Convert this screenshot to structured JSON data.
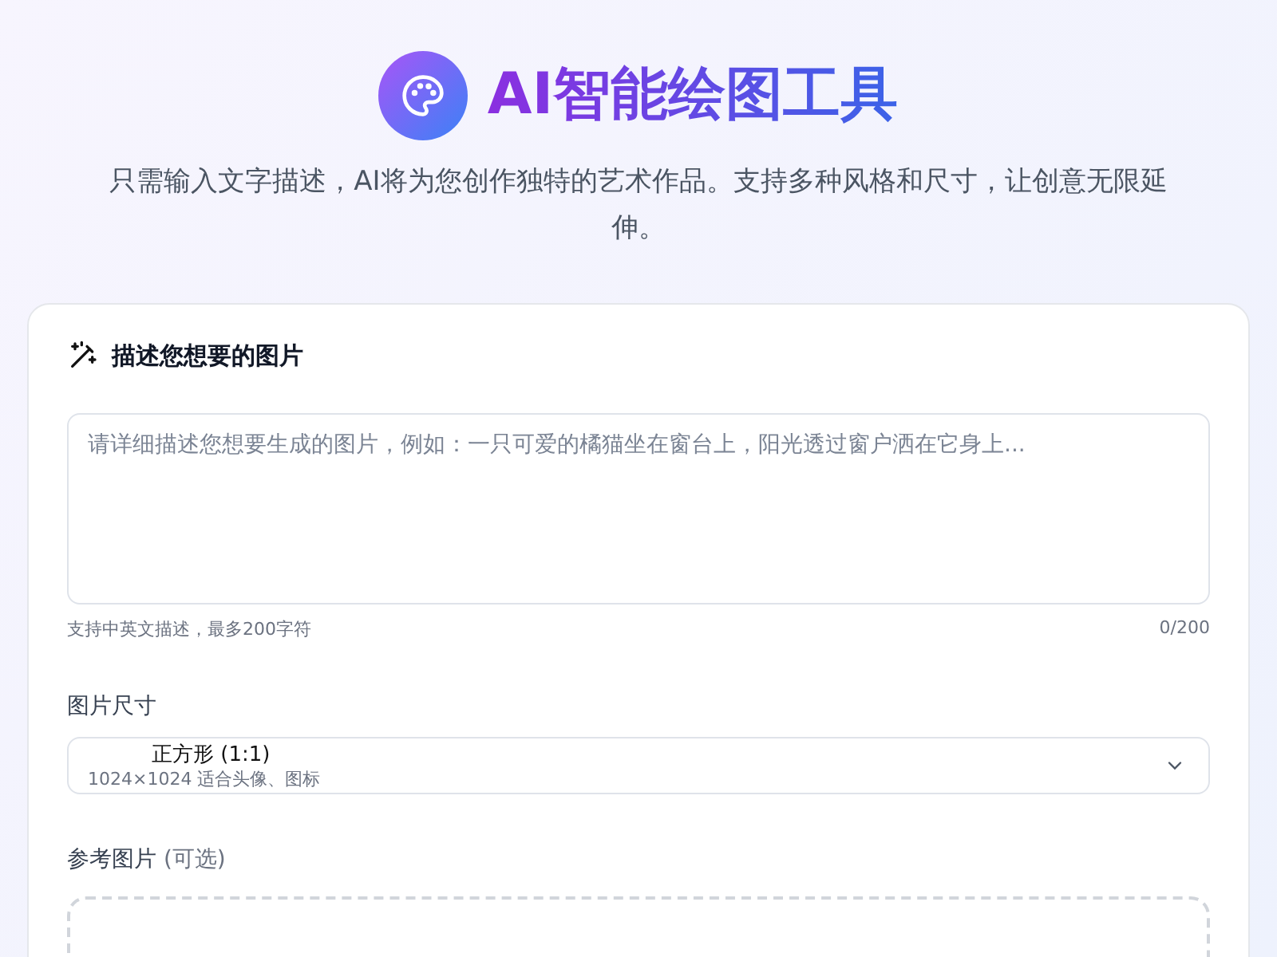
{
  "header": {
    "title": "AI智能绘图工具",
    "subtitle": "只需输入文字描述，AI将为您创作独特的艺术作品。支持多种风格和尺寸，让创意无限延伸。"
  },
  "card": {
    "title": "描述您想要的图片",
    "prompt": {
      "placeholder": "请详细描述您想要生成的图片，例如：一只可爱的橘猫坐在窗台上，阳光透过窗户洒在它身上...",
      "hint": "支持中英文描述，最多200字符",
      "counter": "0/200"
    },
    "size": {
      "label": "图片尺寸",
      "value": "正方形 (1:1)",
      "detail": "1024×1024 适合头像、图标"
    },
    "reference": {
      "label": "参考图片",
      "optional": "(可选)"
    }
  }
}
